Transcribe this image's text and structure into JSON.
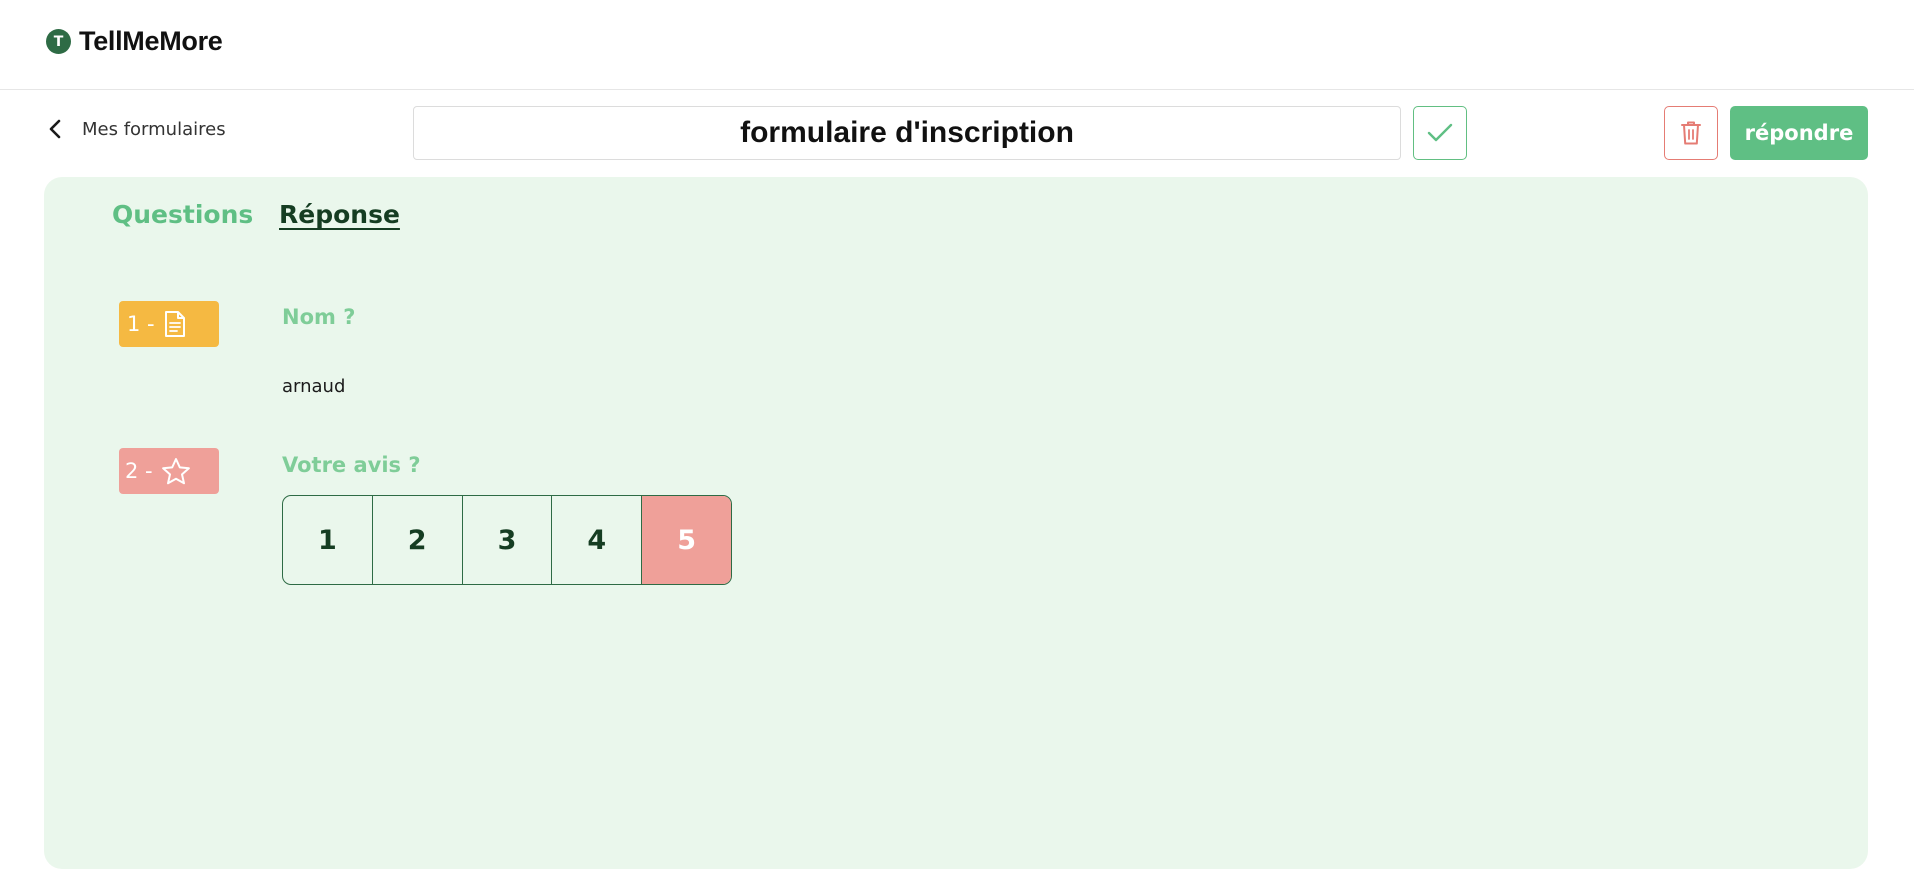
{
  "app": {
    "name": "TellMeMore",
    "logo_letter": "T"
  },
  "toolbar": {
    "back_label": "Mes formulaires",
    "form_title": "formulaire d'inscription",
    "answer_label": "répondre"
  },
  "tabs": [
    {
      "label": "Questions",
      "active": false
    },
    {
      "label": "Réponse",
      "active": true
    }
  ],
  "questions": [
    {
      "number": "1 -",
      "type_icon": "document-icon",
      "label": "Nom ?",
      "answer": "arnaud"
    },
    {
      "number": "2 -",
      "type_icon": "star-icon",
      "label": "Votre avis ?",
      "scale": [
        "1",
        "2",
        "3",
        "4",
        "5"
      ],
      "selected": "5"
    }
  ],
  "colors": {
    "brand_green": "#5fbf84",
    "dark_green": "#2e6b45",
    "panel_bg": "#eaf7ec",
    "text_badge": "#f5b942",
    "rating_badge": "#efa099",
    "delete_red": "#e57c74"
  }
}
